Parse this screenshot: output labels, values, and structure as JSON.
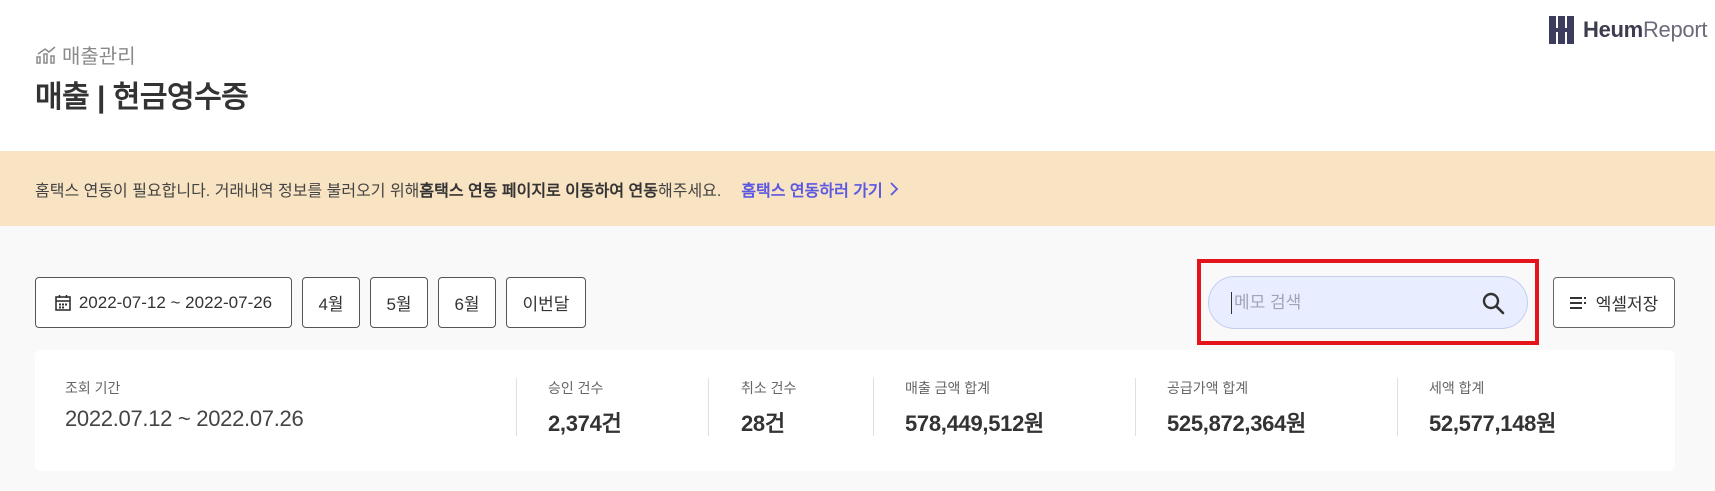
{
  "header": {
    "breadcrumb": "매출관리",
    "title": "매출 | 현금영수증",
    "logo_bold": "Heum",
    "logo_regular": "Report"
  },
  "notice": {
    "text_prefix": "홈택스 연동이 필요합니다. 거래내역 정보를 불러오기 위해 ",
    "text_bold": "홈택스 연동 페이지로 이동하여 연동",
    "text_suffix": "해주세요.",
    "link_label": "홈택스 연동하러 가기"
  },
  "filters": {
    "date_range": "2022-07-12 ~ 2022-07-26",
    "month_buttons": [
      "4월",
      "5월",
      "6월",
      "이번달"
    ]
  },
  "search": {
    "placeholder": "메모 검색",
    "value": ""
  },
  "excel_label": "엑셀저장",
  "summary": {
    "period_label": "조회 기간",
    "period_value": "2022.07.12 ~ 2022.07.26",
    "approved_label": "승인 건수",
    "approved_value": "2,374건",
    "cancel_label": "취소 건수",
    "cancel_value": "28건",
    "sales_label": "매출 금액 합계",
    "sales_value": "578,449,512원",
    "supply_label": "공급가액 합계",
    "supply_value": "525,872,364원",
    "tax_label": "세액 합계",
    "tax_value": "52,577,148원"
  },
  "colors": {
    "accent": "#5b58e2",
    "notice_bg": "#f8e3c2",
    "search_bg": "#e8edff",
    "highlight": "#e3141a"
  }
}
